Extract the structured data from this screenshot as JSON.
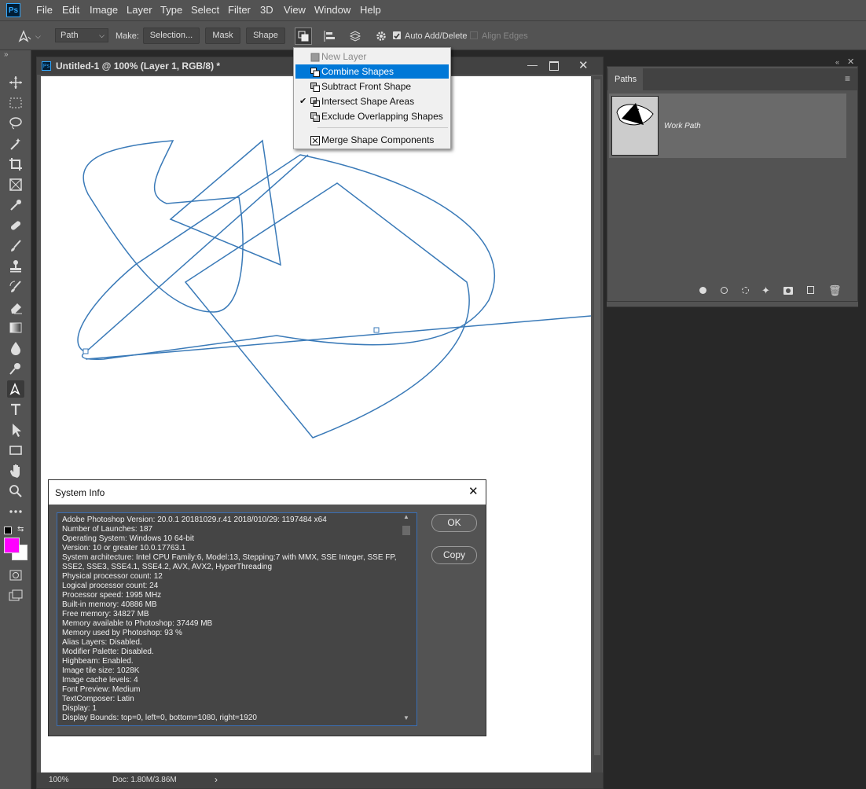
{
  "app": {
    "logo": "Ps",
    "menu": [
      "File",
      "Edit",
      "Image",
      "Layer",
      "Type",
      "Select",
      "Filter",
      "3D",
      "View",
      "Window",
      "Help"
    ]
  },
  "options_bar": {
    "mode_value": "Path",
    "make_label": "Make:",
    "selection_button": "Selection...",
    "mask_button": "Mask",
    "shape_button": "Shape",
    "auto_add_delete_label": "Auto Add/Delete",
    "auto_add_delete_checked": true,
    "align_edges_label": "Align Edges",
    "align_edges_checked": false
  },
  "path_operations_menu": {
    "items": [
      {
        "label": "New Layer",
        "state": "disabled",
        "icon": "new-layer-icon"
      },
      {
        "label": "Combine Shapes",
        "state": "highlighted",
        "icon": "combine-shapes-icon"
      },
      {
        "label": "Subtract Front Shape",
        "state": "normal",
        "icon": "subtract-front-shape-icon"
      },
      {
        "label": "Intersect Shape Areas",
        "state": "checked",
        "icon": "intersect-shape-areas-icon"
      },
      {
        "label": "Exclude Overlapping Shapes",
        "state": "normal",
        "icon": "exclude-overlapping-icon"
      },
      {
        "label": "Merge Shape Components",
        "state": "normal",
        "icon": "merge-components-icon"
      }
    ]
  },
  "document": {
    "title": "Untitled-1 @ 100% (Layer 1, RGB/8) *",
    "zoom": "100%",
    "doc_size": "Doc: 1.80M/3.86M"
  },
  "tools": [
    "move-tool-icon",
    "marquee-tool-icon",
    "lasso-tool-icon",
    "quick-selection-icon",
    "crop-tool-icon",
    "frame-tool-icon",
    "eyedropper-icon",
    "healing-brush-icon",
    "brush-tool-icon",
    "clone-stamp-icon",
    "history-brush-icon",
    "eraser-icon",
    "gradient-icon",
    "blur-icon",
    "dodge-icon",
    "pen-tool-icon",
    "type-tool-icon",
    "path-selection-icon",
    "rectangle-tool-icon",
    "hand-tool-icon",
    "zoom-tool-icon",
    "more-tools-icon"
  ],
  "colors": {
    "foreground": "#ff00ff",
    "background": "#ffffff",
    "path_stroke": "#3a7ab8",
    "menu_highlight": "#0078d7"
  },
  "paths_panel": {
    "tab_label": "Paths",
    "items": [
      {
        "name": "Work Path"
      }
    ]
  },
  "system_info": {
    "title": "System Info",
    "ok_button": "OK",
    "copy_button": "Copy",
    "lines": [
      "Adobe Photoshop Version: 20.0.1 20181029.r.41 2018/010/29: 1197484  x64",
      "Number of Launches: 187",
      "Operating System: Windows 10 64-bit",
      "Version: 10 or greater 10.0.17763.1",
      "System architecture: Intel CPU Family:6, Model:13, Stepping:7 with MMX, SSE Integer, SSE FP,",
      "SSE2, SSE3, SSE4.1, SSE4.2, AVX, AVX2, HyperThreading",
      "Physical processor count: 12",
      "Logical processor count: 24",
      "Processor speed: 1995 MHz",
      "Built-in memory: 40886 MB",
      "Free memory: 34827 MB",
      "Memory available to Photoshop: 37449 MB",
      "Memory used by Photoshop: 93 %",
      "Alias Layers: Disabled.",
      "Modifier Palette: Disabled.",
      "Highbeam: Enabled.",
      "Image tile size: 1028K",
      "Image cache levels: 4",
      "Font Preview: Medium",
      "TextComposer: Latin",
      "Display: 1",
      "Display Bounds: top=0, left=0, bottom=1080, right=1920"
    ]
  }
}
